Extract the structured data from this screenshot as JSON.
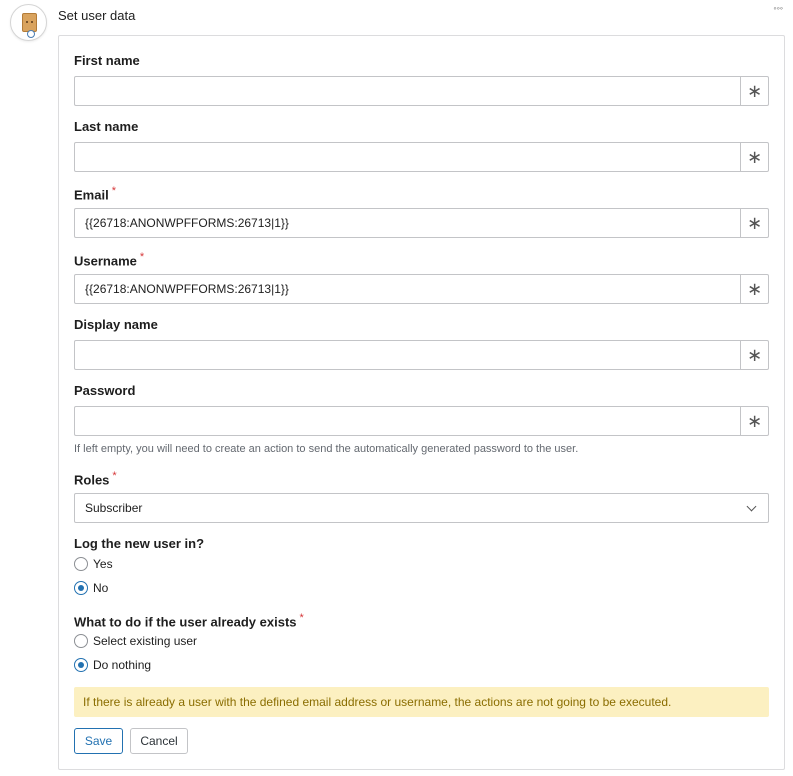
{
  "header": {
    "title": "Set user data"
  },
  "fields": [
    {
      "label": "First name",
      "value": "",
      "required": false
    },
    {
      "label": "Last name",
      "value": "",
      "required": false
    },
    {
      "label": "Email",
      "value": "{{26718:ANONWPFFORMS:26713|1}}",
      "required": true
    },
    {
      "label": "Username",
      "value": "{{26718:ANONWPFFORMS:26713|1}}",
      "required": true
    },
    {
      "label": "Display name",
      "value": "",
      "required": false
    },
    {
      "label": "Password",
      "value": "",
      "required": false
    }
  ],
  "required_mark": "*",
  "field_action_symbol": "∗",
  "password_help": "If left empty, you will need to create an action to send the automatically generated password to the user.",
  "roles": {
    "label": "Roles",
    "selected": "Subscriber"
  },
  "login": {
    "label": "Log the new user in?",
    "options": [
      "Yes",
      "No"
    ],
    "selected": "No"
  },
  "exists": {
    "label": "What to do if the user already exists",
    "options": [
      "Select existing user",
      "Do nothing"
    ],
    "selected": "Do nothing"
  },
  "notice": "If there is already a user with the defined email address or username, the actions are not going to be executed.",
  "buttons": {
    "save": "Save",
    "cancel": "Cancel"
  },
  "colors": {
    "accent": "#2271b1",
    "required": "#d63638",
    "notice_bg": "#fcf0c1",
    "notice_text": "#8a6d00"
  }
}
